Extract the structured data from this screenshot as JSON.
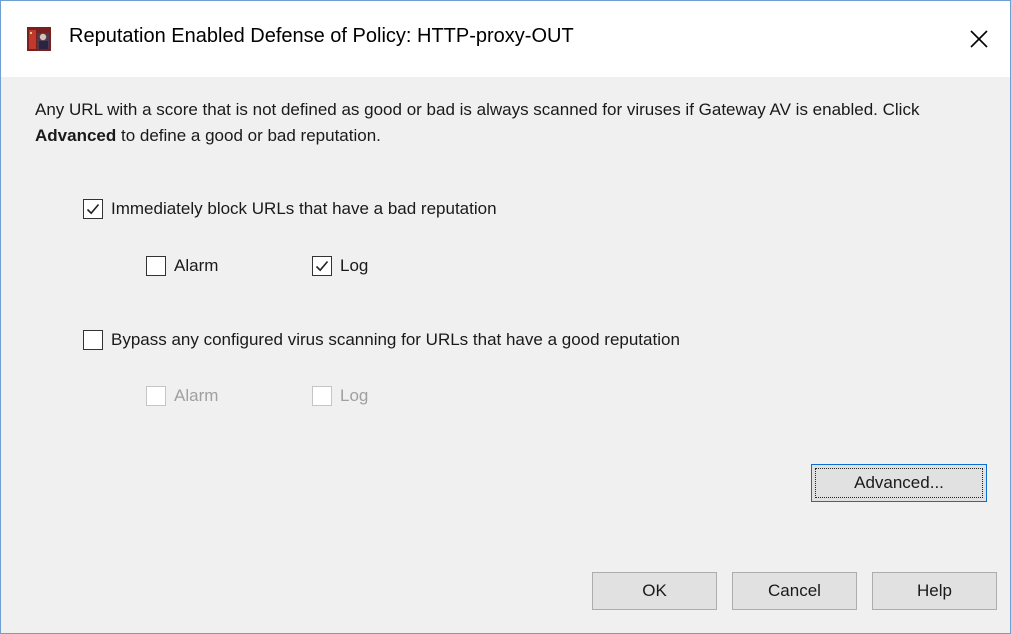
{
  "window": {
    "title": "Reputation Enabled Defense of Policy: HTTP-proxy-OUT",
    "icon": "firebox-app-icon",
    "close_icon": "close-icon"
  },
  "description": {
    "before_bold": "Any URL with a score that is not defined as good or bad is always scanned for viruses if Gateway AV is enabled. Click ",
    "bold": "Advanced",
    "after_bold": " to define a good or bad reputation."
  },
  "block_bad": {
    "label": "Immediately block URLs that have a bad reputation",
    "checked": true,
    "alarm": {
      "label": "Alarm",
      "checked": false,
      "enabled": true
    },
    "log": {
      "label": "Log",
      "checked": true,
      "enabled": true
    }
  },
  "bypass_good": {
    "label": "Bypass any configured virus scanning for URLs that have a good reputation",
    "checked": false,
    "alarm": {
      "label": "Alarm",
      "checked": false,
      "enabled": false
    },
    "log": {
      "label": "Log",
      "checked": false,
      "enabled": false
    }
  },
  "buttons": {
    "advanced": "Advanced...",
    "ok": "OK",
    "cancel": "Cancel",
    "help": "Help"
  },
  "colors": {
    "dialog_bg": "#f0f0f0",
    "titlebar_bg": "#ffffff",
    "window_border": "#6f9fd0",
    "focus_border": "#0b6fd1"
  }
}
